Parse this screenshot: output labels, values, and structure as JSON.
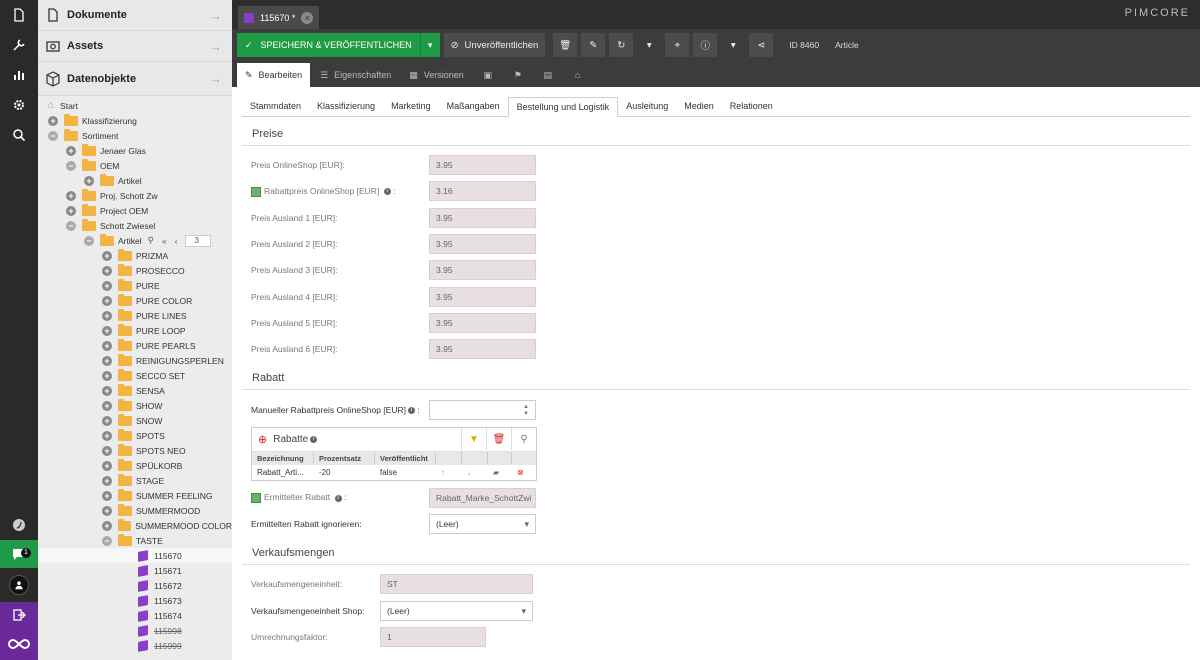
{
  "sidebar": {
    "panels": {
      "documents": "Dokumente",
      "assets": "Assets",
      "data_objects": "Datenobjekte"
    },
    "chat_badge": "1",
    "tree": {
      "start": "Start",
      "klassifizierung": "Klassifizierung",
      "sortiment": "Sortiment",
      "jenaer": "Jenaer Glas",
      "oem": "OEM",
      "oem_artikel": "Artikel",
      "proj_schott": "Proj. Schott Zw",
      "project_oem": "Project OEM",
      "schott_zwiesel": "Schott Zwiesel",
      "artikel": "Artikel",
      "page_value": "3",
      "folders": [
        "PRIZMA",
        "PROSECCO",
        "PURE",
        "PURE COLOR",
        "PURE LINES",
        "PURE LOOP",
        "PURE PEARLS",
        "REINIGUNGSPERLEN",
        "SECCO SET",
        "SENSA",
        "SHOW",
        "SNOW",
        "SPOTS",
        "SPOTS NEO",
        "SPÜLKORB",
        "STAGE",
        "SUMMER FEELING",
        "SUMMERMOOD",
        "SUMMERMOOD COLOR",
        "TASTE"
      ],
      "items": [
        "115670",
        "115671",
        "115672",
        "115673",
        "115674",
        "115998",
        "115999"
      ]
    }
  },
  "tab": {
    "title": "115670 *"
  },
  "brand": "PIMCORE",
  "toolbar": {
    "save_publish": "SPEICHERN & VERÖFFENTLICHEN",
    "unpublish": "Unveröffentlichen",
    "id": "ID 8460",
    "class_name": "Article"
  },
  "subtabs": {
    "edit": "Bearbeiten",
    "properties": "Eigenschaften",
    "versions": "Versionen"
  },
  "inner_tabs": [
    "Stammdaten",
    "Klassifizierung",
    "Marketing",
    "Maßangaben",
    "Bestellung und Logistik",
    "Ausleitung",
    "Medien",
    "Relationen"
  ],
  "preise": {
    "title": "Preise",
    "rows": [
      {
        "label": "Preis OnlineShop [EUR]:",
        "value": "3.95"
      },
      {
        "label": "Rabattpreis OnlineShop [EUR]",
        "value": "3.16"
      },
      {
        "label": "Preis Ausland 1 [EUR]:",
        "value": "3.95"
      },
      {
        "label": "Preis Ausland 2 [EUR]:",
        "value": "3.95"
      },
      {
        "label": "Preis Ausland 3 [EUR]:",
        "value": "3.95"
      },
      {
        "label": "Preis Ausland 4 [EUR]:",
        "value": "3.95"
      },
      {
        "label": "Preis Ausland 5 [EUR]:",
        "value": "3.95"
      },
      {
        "label": "Preis Ausland 6 [EUR]:",
        "value": "3.95"
      }
    ]
  },
  "rabatt": {
    "title": "Rabatt",
    "manual_label": "Manueller Rabattpreis OnlineShop [EUR]",
    "grid_title": "Rabatte",
    "col_name": "Bezeichnung",
    "col_percent": "Prozentsatz",
    "col_published": "Veröffentlicht",
    "row_name": "Rabatt_Arti...",
    "row_percent": "-20",
    "row_published": "false",
    "determined_label": "Ermittelter Rabatt",
    "determined_value": "Rabatt_Marke_SchottZwi",
    "ignore_label": "Ermittelten Rabatt ignorieren:",
    "ignore_value": "(Leer)"
  },
  "verkauf": {
    "title": "Verkaufsmengen",
    "unit_label": "Verkaufsmengeneinheit:",
    "unit_value": "ST",
    "shop_label": "Verkaufsmengeneinheit Shop:",
    "shop_value": "(Leer)",
    "factor_label": "Umrechnungsfaktor:",
    "factor_value": "1"
  },
  "colors": {
    "save_green": "#1f9b45",
    "purple": "#6a2a9a",
    "folder": "#f3b443",
    "object_cube": "#8a3fc8"
  }
}
